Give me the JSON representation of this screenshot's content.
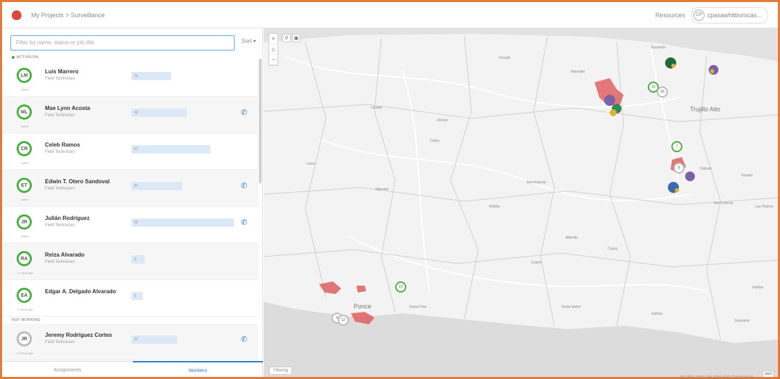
{
  "header": {
    "crumb": "My Projects > Surveillance",
    "resources": "Resources",
    "user_initials": "CP",
    "user_name": "cpasawhitburscás..."
  },
  "left": {
    "filter_placeholder": "Filter by name, status or job title",
    "sort_label": "Sort ▾",
    "section_active": "ACTIVE/ON",
    "section_not_working": "NOT WORKING",
    "workers": [
      {
        "initials": "LM",
        "name": "Luis Marrero",
        "role": "Field Technician",
        "sub": "Active",
        "bar": "31",
        "bar_pct": 0.33,
        "phone": false,
        "alt": false
      },
      {
        "initials": "ML",
        "name": "Mae Lynn Acosta",
        "role": "Field Technician",
        "sub": "Active",
        "bar": "42",
        "bar_pct": 0.5,
        "phone": true,
        "alt": true
      },
      {
        "initials": "CR",
        "name": "Celeb Ramos",
        "role": "Field Technician",
        "sub": "Active",
        "bar": "67",
        "bar_pct": 0.75,
        "phone": false,
        "alt": false
      },
      {
        "initials": "ET",
        "name": "Edwin T. Otero Sandoval",
        "role": "Field Technician",
        "sub": "Active",
        "bar": "41",
        "bar_pct": 0.45,
        "phone": true,
        "alt": true
      },
      {
        "initials": "JR",
        "name": "Julián Rodríguez",
        "role": "Field Technician",
        "sub": "Active",
        "bar": "92",
        "bar_pct": 1.0,
        "phone": true,
        "alt": false
      },
      {
        "initials": "RA",
        "name": "Reiza Alvarado",
        "role": "Field Technician",
        "sub": "17 hours ago",
        "bar": "3",
        "bar_pct": 0.05,
        "phone": false,
        "alt": true
      },
      {
        "initials": "EA",
        "name": "Edgar A. Delgado Alvarado",
        "role": "",
        "sub": "17 hours ago",
        "bar": "1",
        "bar_pct": 0.03,
        "phone": false,
        "alt": false
      },
      {
        "initials": "JR",
        "name": "Jeremy Rodríguez Cortes",
        "role": "Field Technician",
        "sub": "14 hours ago",
        "bar": "37",
        "bar_pct": 0.4,
        "phone": true,
        "alt": true,
        "grey": true
      }
    ],
    "tab_assignments": "Assignments",
    "tab_workers": "Workers"
  },
  "map": {
    "filter_chip": "Filtering",
    "attribution": "Esri, HERE, Garmin, FAO, NOAA, USGS | Powered by Esri",
    "esri": "esri",
    "labels": {
      "ponce": "Ponce",
      "trujillo": "Trujillo Alto",
      "cayey": "Cayey",
      "utuado": "Utuado",
      "lares": "Lares",
      "ciales": "Ciales",
      "juana_diaz": "Juana Díaz",
      "guayama": "Guayama",
      "caguas": "Caguas",
      "barranquitas": "Barranquitas",
      "aibonito": "Aibonito",
      "coamo": "Coamo",
      "adjuntas": "Adjuntas",
      "jayuya": "Jayuya",
      "villalba": "Villalba",
      "santa_isabel": "Santa Isabel",
      "salinas": "Salinas",
      "gurabo": "Gurabo",
      "las_piedras": "Las Piedras",
      "san_lorenzo": "San Lorenzo",
      "patillas": "Patillas",
      "naranjito": "Naranjito",
      "bayamon": "Bayamón",
      "dorado": "Dorado"
    },
    "clusters": [
      {
        "label": "15"
      },
      {
        "label": "25"
      },
      {
        "label": "7"
      },
      {
        "label": "8"
      },
      {
        "label": "10"
      },
      {
        "label": "9"
      },
      {
        "label": "12"
      }
    ]
  }
}
